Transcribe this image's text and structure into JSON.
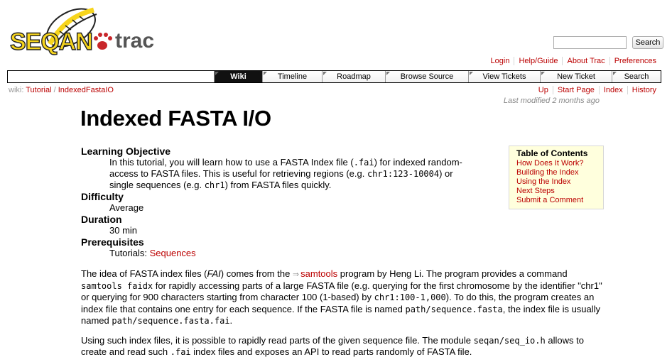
{
  "header": {
    "logo_text_1": "SEQAN",
    "logo_text_2": "trac",
    "search_label": "Search"
  },
  "metanav": [
    "Login",
    "Help/Guide",
    "About Trac",
    "Preferences"
  ],
  "mainnav": [
    "Wiki",
    "Timeline",
    "Roadmap",
    "Browse Source",
    "View Tickets",
    "New Ticket",
    "Search"
  ],
  "active_tab": "Wiki",
  "breadcrumb": {
    "prefix": "wiki:",
    "items": [
      "Tutorial",
      "IndexedFastaIO"
    ],
    "separator": "/"
  },
  "ctxtnav": [
    "Up",
    "Start Page",
    "Index",
    "History"
  ],
  "last_modified": "Last modified 2 months ago",
  "page": {
    "title": "Indexed FASTA I/O",
    "info": {
      "objective_label": "Learning Objective",
      "objective_parts": [
        "In this tutorial, you will learn how to use a FASTA Index file (",
        ".fai",
        ") for indexed random-access to FASTA files. This is useful for retrieving regions (e.g. ",
        "chr1:123-10004",
        ") or single sequences (e.g. ",
        "chr1",
        ") from FASTA files quickly."
      ],
      "difficulty_label": "Difficulty",
      "difficulty_value": "Average",
      "duration_label": "Duration",
      "duration_value": "30 min",
      "prereq_label": "Prerequisites",
      "prereq_prefix": "Tutorials:",
      "prereq_link": "Sequences"
    },
    "toc": {
      "title": "Table of Contents",
      "items": [
        "How Does It Work?",
        "Building the Index",
        "Using the Index",
        "Next Steps",
        "Submit a Comment"
      ]
    },
    "para1": {
      "t1": "The idea of FASTA index files (",
      "t1_em": "FAI",
      "t2": ") comes from the ",
      "link_icon": "⇒",
      "link": "samtools",
      "t3": " program by Heng Li. The program provides a command ",
      "code1": "samtools faidx",
      "t4": " for rapidly accessing parts of a large FASTA file (e.g. querying for the first chromosome by the identifier \"chr1\" or querying for 900 characters starting from character 100 (1-based) by ",
      "code2": "chr1:100-1,000",
      "t5": "). To do this, the program creates an index file that contains one entry for each sequence. If the FASTA file is named ",
      "code3": "path/sequence.fasta",
      "t6": ", the index file is usually named ",
      "code4": "path/sequence.fasta.fai",
      "t7": "."
    },
    "para2": {
      "t1": "Using such index files, it is possible to rapidly read parts of the given sequence file. The module ",
      "code1": "seqan/seq_io.h",
      "t2": " allows to create and read such ",
      "code2": ".fai",
      "t3": " index files and exposes an API to read parts randomly of FASTA file."
    }
  },
  "colors": {
    "link": "#bb0000",
    "accent_yellow": "#f7d51d",
    "toc_bg": "#ffffdd",
    "active_tab_bg": "#111111"
  }
}
